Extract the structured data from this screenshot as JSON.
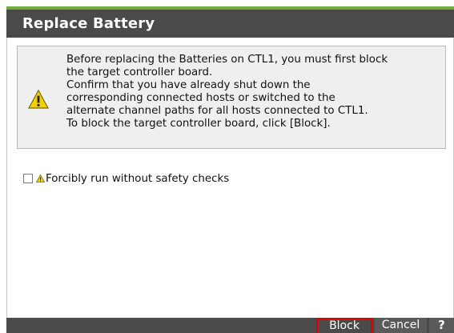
{
  "dialog": {
    "title": "Replace Battery"
  },
  "warning": {
    "icon": "warning-icon",
    "lines": [
      "Before replacing the Batteries on CTL1, you must first block",
      "the target controller board.",
      "Confirm that you have already shut down the",
      "corresponding connected hosts or switched to the",
      "alternate channel paths for all hosts connected to CTL1.",
      "To block the target controller board, click [Block]."
    ]
  },
  "options": {
    "force_label": "Forcibly run without safety checks",
    "force_checked": false
  },
  "footer": {
    "block_label": "Block",
    "cancel_label": "Cancel",
    "help_label": "?"
  },
  "colors": {
    "titlebar": "#4a4a4a",
    "accent": "#6fae3a",
    "highlight": "#e00000",
    "warning_yellow": "#f5d000"
  }
}
